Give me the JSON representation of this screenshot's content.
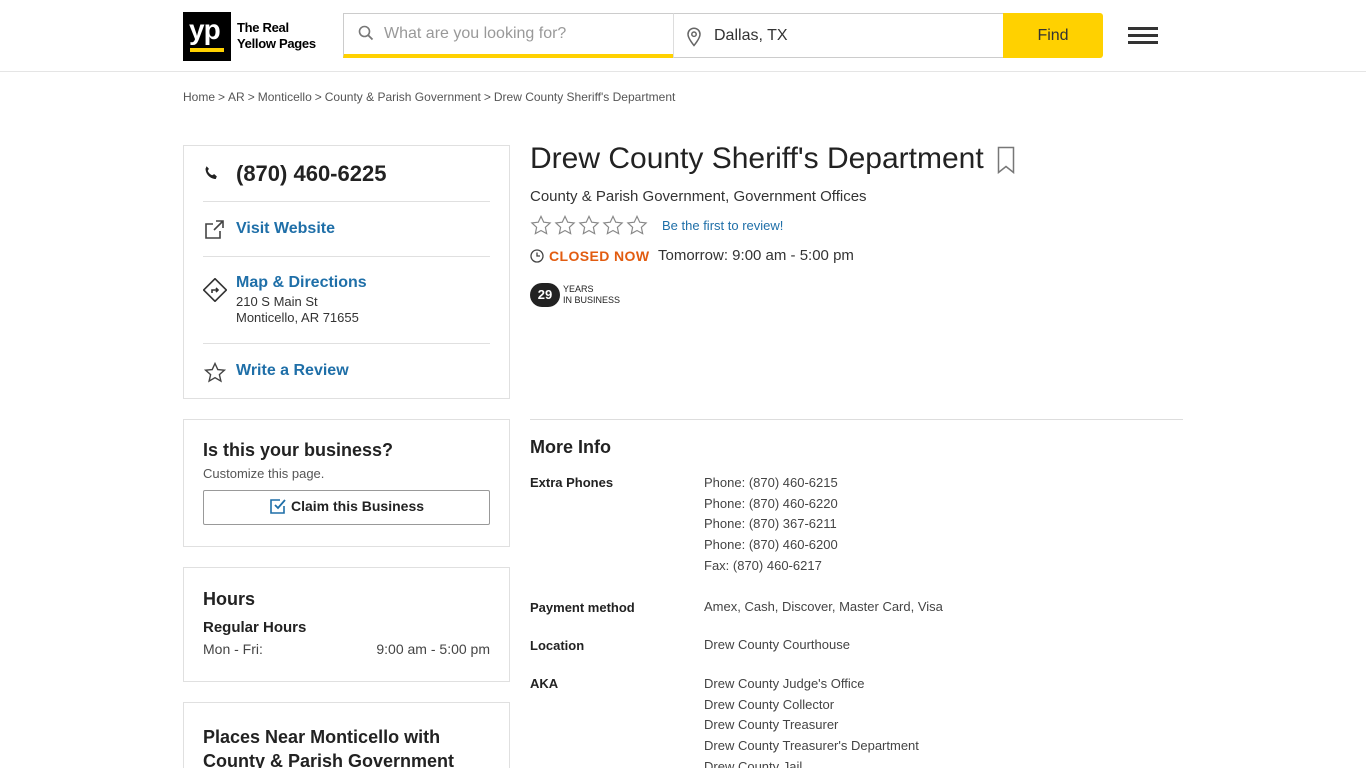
{
  "header": {
    "logo_mark": "yp",
    "logo_line1": "The Real",
    "logo_line2": "Yellow Pages",
    "search_placeholder": "What are you looking for?",
    "location_value": "Dallas, TX",
    "find_label": "Find",
    "accent_color": "#ffd100"
  },
  "breadcrumb": [
    "Home",
    "AR",
    "Monticello",
    "County & Parish Government",
    "Drew County Sheriff's Department"
  ],
  "contact": {
    "phone": "(870) 460-6225",
    "visit_website": "Visit Website",
    "map_directions": "Map & Directions",
    "address_line1": "210 S Main St",
    "address_line2": "Monticello, AR 71655",
    "write_review": "Write a Review"
  },
  "claim": {
    "title": "Is this your business?",
    "subtitle": "Customize this page.",
    "button": "Claim this Business"
  },
  "hours": {
    "title": "Hours",
    "subtitle": "Regular Hours",
    "day": "Mon - Fri:",
    "time": "9:00 am - 5:00 pm"
  },
  "places": {
    "title": "Places Near Monticello with County & Parish Government"
  },
  "business": {
    "name": "Drew County Sheriff's Department",
    "category1": "County & Parish Government,",
    "category2": "Government Offices",
    "rating_stars": 0,
    "review_prompt": "Be the first to review!",
    "status": "CLOSED NOW",
    "status_color": "#e25c10",
    "tomorrow": "Tomorrow: 9:00 am - 5:00 pm",
    "years": "29",
    "years_label1": "Years",
    "years_label2": "in Business"
  },
  "more_info": {
    "title": "More Info",
    "extra_phones_label": "Extra Phones",
    "extra_phones": [
      "Phone: (870) 460-6215",
      "Phone: (870) 460-6220",
      "Phone: (870) 367-6211",
      "Phone: (870) 460-6200",
      "Fax: (870) 460-6217"
    ],
    "payment_label": "Payment method",
    "payment_value": "Amex, Cash, Discover, Master Card, Visa",
    "location_label": "Location",
    "location_value": "Drew County Courthouse",
    "aka_label": "AKA",
    "aka": [
      "Drew County Judge's Office",
      "Drew County Collector",
      "Drew County Treasurer",
      "Drew County Treasurer's Department",
      "Drew County Jail"
    ]
  }
}
